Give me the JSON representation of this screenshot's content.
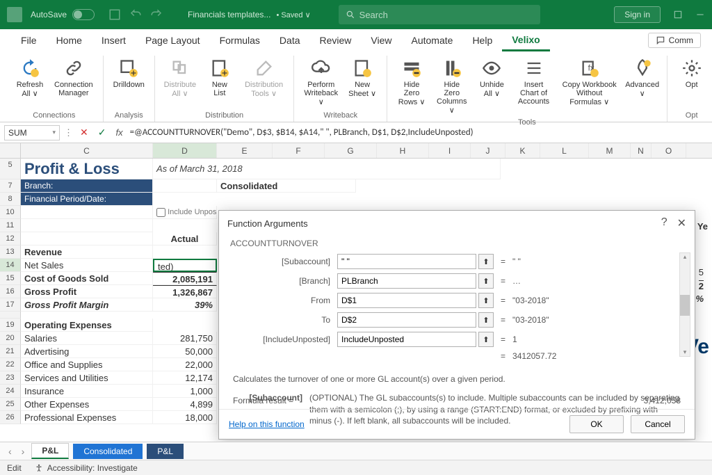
{
  "titlebar": {
    "autosave": "AutoSave",
    "filename": "Financials templates...",
    "saved_state": "• Saved ∨",
    "search_placeholder": "Search",
    "signin": "Sign in"
  },
  "tabs": {
    "file": "File",
    "home": "Home",
    "insert": "Insert",
    "page_layout": "Page Layout",
    "formulas": "Formulas",
    "data": "Data",
    "review": "Review",
    "view": "View",
    "automate": "Automate",
    "help": "Help",
    "velixo": "Velixo",
    "comments": "Comm"
  },
  "ribbon": {
    "refresh": "Refresh All ∨",
    "conn_mgr": "Connection Manager",
    "g_connections": "Connections",
    "drilldown": "Drilldown",
    "g_analysis": "Analysis",
    "distribute_all": "Distribute All ∨",
    "new_list": "New List",
    "dist_tools": "Distribution Tools ∨",
    "g_distribution": "Distribution",
    "perform_wb": "Perform Writeback ∨",
    "new_sheet": "New Sheet ∨",
    "g_writeback": "Writeback",
    "hide_rows": "Hide Zero Rows ∨",
    "hide_cols": "Hide Zero Columns ∨",
    "unhide": "Unhide All ∨",
    "insert_coa": "Insert Chart of Accounts",
    "copy_wof": "Copy Workbook Without Formulas ∨",
    "advanced": "Advanced ∨",
    "g_tools": "Tools",
    "opt": "Opt",
    "g_opt": "Opt"
  },
  "formulabar": {
    "namebox": "SUM",
    "formula": "=@ACCOUNTTURNOVER(\"Demo\", D$3, $B14, $A14,\" \", PLBranch, D$1, D$2,IncludeUnposted)"
  },
  "columns": [
    "C",
    "D",
    "E",
    "F",
    "G",
    "H",
    "I",
    "J",
    "K",
    "L",
    "M",
    "N",
    "O"
  ],
  "sheet": {
    "title": "Profit & Loss",
    "asof": "As of March 31, 2018",
    "branch_label": "Branch:",
    "period_label": "Financial Period/Date:",
    "consolidated": "Consolidated",
    "include_unposted_cb": "Include Unposted",
    "actual": "Actual",
    "revenue": "Revenue",
    "net_sales": " Net Sales",
    "net_sales_val": "ted)",
    "cogs": "Cost of Goods Sold",
    "cogs_val": "2,085,191",
    "gross_profit": "Gross Profit",
    "gross_profit_val": "1,326,867",
    "gp_margin": "Gross Profit Margin",
    "gp_margin_val": "39%",
    "opex": "Operating Expenses",
    "salaries": " Salaries",
    "salaries_val": "281,750",
    "advertising": " Advertising",
    "advertising_val": "50,000",
    "office": " Office and Supplies",
    "office_val": "22,000",
    "services": " Services and Utilities",
    "services_val": "12,174",
    "insurance": " Insurance",
    "insurance_val": "1,000",
    "other": " Other Expenses",
    "other_val": "4,899",
    "prof": " Professional Expenses",
    "prof_val": "18,000",
    "logo_partial": "Ve",
    "ycol": "Ye",
    "val1": "5",
    "val2": "2",
    "pct": "%"
  },
  "dialog": {
    "title": "Function Arguments",
    "function": "ACCOUNTTURNOVER",
    "args": [
      {
        "label": "[Subaccount]",
        "value": "\" \"",
        "result": "\" \""
      },
      {
        "label": "[Branch]",
        "value": "PLBranch",
        "result": "…"
      },
      {
        "label": "From",
        "value": "D$1",
        "result": "\"03-2018\""
      },
      {
        "label": "To",
        "value": "D$2",
        "result": "\"03-2018\""
      },
      {
        "label": "[IncludeUnposted]",
        "value": "IncludeUnposted",
        "result": "1"
      }
    ],
    "preview_result": "3412057.72",
    "description": "Calculates the turnover of one or more GL account(s) over a given period.",
    "param_name": "[Subaccount]",
    "param_desc": "(OPTIONAL) The GL subaccounts(s) to include. Multiple subaccounts can be included by separating them with a semicolon (;), by using a range (START:END) format, or excluded by prefixing with minus (-). If left blank, all subaccounts will be included.",
    "formula_result_label": "Formula result =",
    "formula_result": "3,412,058",
    "help": "Help on this function",
    "ok": "OK",
    "cancel": "Cancel"
  },
  "sheettabs": {
    "pl": "P&L",
    "consolidated": "Consolidated",
    "pl2": "P&L"
  },
  "status": {
    "edit": "Edit",
    "accessibility": "Accessibility: Investigate"
  }
}
